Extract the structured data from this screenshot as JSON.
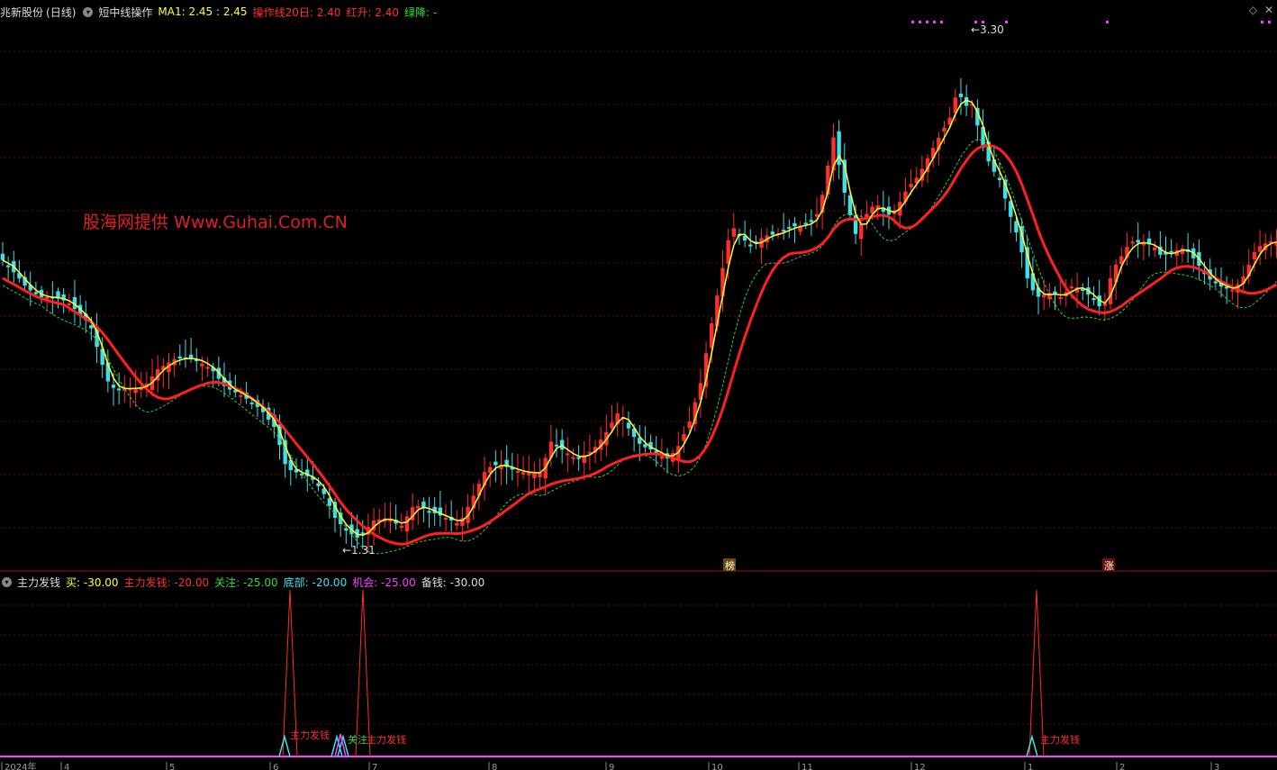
{
  "top_header": {
    "stock_name": "兆新股份",
    "period": "(日线)",
    "indicator_name": "短中线操作",
    "ma1_label": "MA1: 2.45 : 2.45",
    "ops_label": "操作线20日: 2.40",
    "red_label": "红升: 2.40",
    "green_label": "绿降: -"
  },
  "bottom_header": {
    "indicator_name": "主力发钱",
    "buy": "买: -30.00",
    "main": "主力发钱: -20.00",
    "focus": "关注: -25.00",
    "bottom": "底部: -20.00",
    "chance": "机会: -25.00",
    "reserve": "备钱: -30.00"
  },
  "watermark": "股海网提供 Www.Guhai.Com.CN",
  "annotations": {
    "high": "3.30",
    "low": "1.31",
    "badge_bang": "榜",
    "badge_zhang": "涨"
  },
  "signal_labels": {
    "main": "主力发钱",
    "focus": "关注"
  },
  "x_axis": [
    "2024年",
    "4",
    "5",
    "6",
    "7",
    "8",
    "9",
    "10",
    "11",
    "12",
    "1",
    "2",
    "3"
  ],
  "colors": {
    "up": "#ff2d2d",
    "down": "#3fe0e8",
    "ma": "#ffff33",
    "ops": "#ff2020",
    "trend": "#33cc33",
    "sig": "#ff40ff"
  },
  "chart_data": [
    {
      "type": "candlestick",
      "ylim": [
        1.2,
        3.4
      ],
      "annotations": {
        "high": 3.3,
        "low": 1.31
      }
    },
    {
      "type": "line",
      "title": "主力发钱",
      "spikes": [
        "主力发钱",
        "主力发钱",
        "主力发钱"
      ]
    }
  ]
}
